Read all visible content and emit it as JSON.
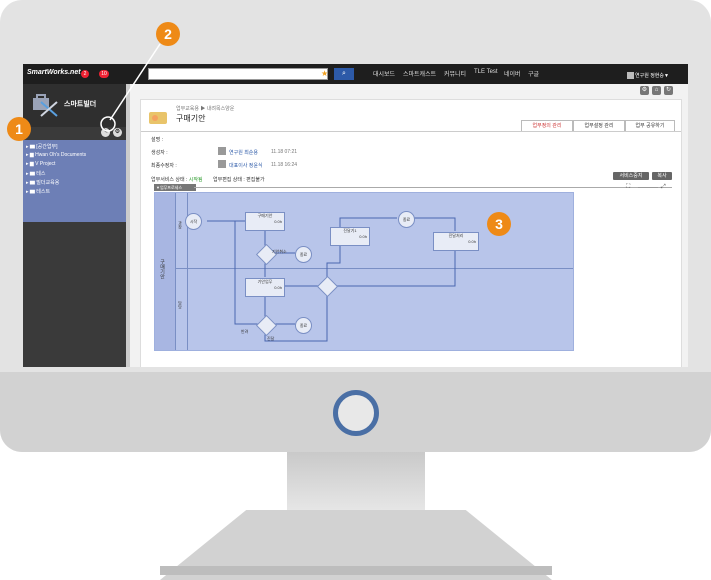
{
  "markers": {
    "m1": "1",
    "m2": "2",
    "m3": "3"
  },
  "topbar": {
    "logo": "SmartWorks.net",
    "notif1": "2",
    "notif2": "10",
    "nav": [
      "대시보드",
      "스마트캐스트",
      "커뮤니티",
      "TLE Test",
      "네이버",
      "구글"
    ],
    "user": "연구원 정현승▼"
  },
  "sidebar": {
    "title": "스마트빌더",
    "items": [
      "[공간업무]",
      "Hwan Oh's Documents",
      "V Project",
      "테스",
      "빌더교육용",
      "테스트"
    ]
  },
  "content": {
    "breadcrumb": "업무교육용 ▶ 내려목스양운",
    "title": "구매기안",
    "tabs": [
      "업무정의 관리",
      "업무설정 관리",
      "업무 공유하기"
    ],
    "desc_label": "설명 :",
    "creator_label": "생성자 :",
    "creator_value": "연구원 최순용",
    "creator_time": "11.18 07:21",
    "modifier_label": "최종수정자 :",
    "modifier_value": "대표이사 정윤식",
    "modifier_time": "11.18 16:24",
    "status_line_prefix": "업무서비스 상태 : ",
    "status_value": "시작됨",
    "edit_status": "업무편집 상태 : 편집불가",
    "btn_service_stop": "서비스중지",
    "btn_copy": "복사",
    "diagram_toggle": "▼업무프로세스"
  },
  "diagram": {
    "lanes": [
      "구매기안",
      "과장",
      "담당"
    ],
    "start": "시작",
    "task1": "구매기안",
    "task2": "기안업무",
    "task3": "진달기1",
    "task4": "진달처리",
    "end1": "종료",
    "end2": "종료",
    "end3": "종료",
    "time": "0.0h",
    "flow1": "기안취소",
    "flow2": "반려",
    "flow3": "진달"
  }
}
